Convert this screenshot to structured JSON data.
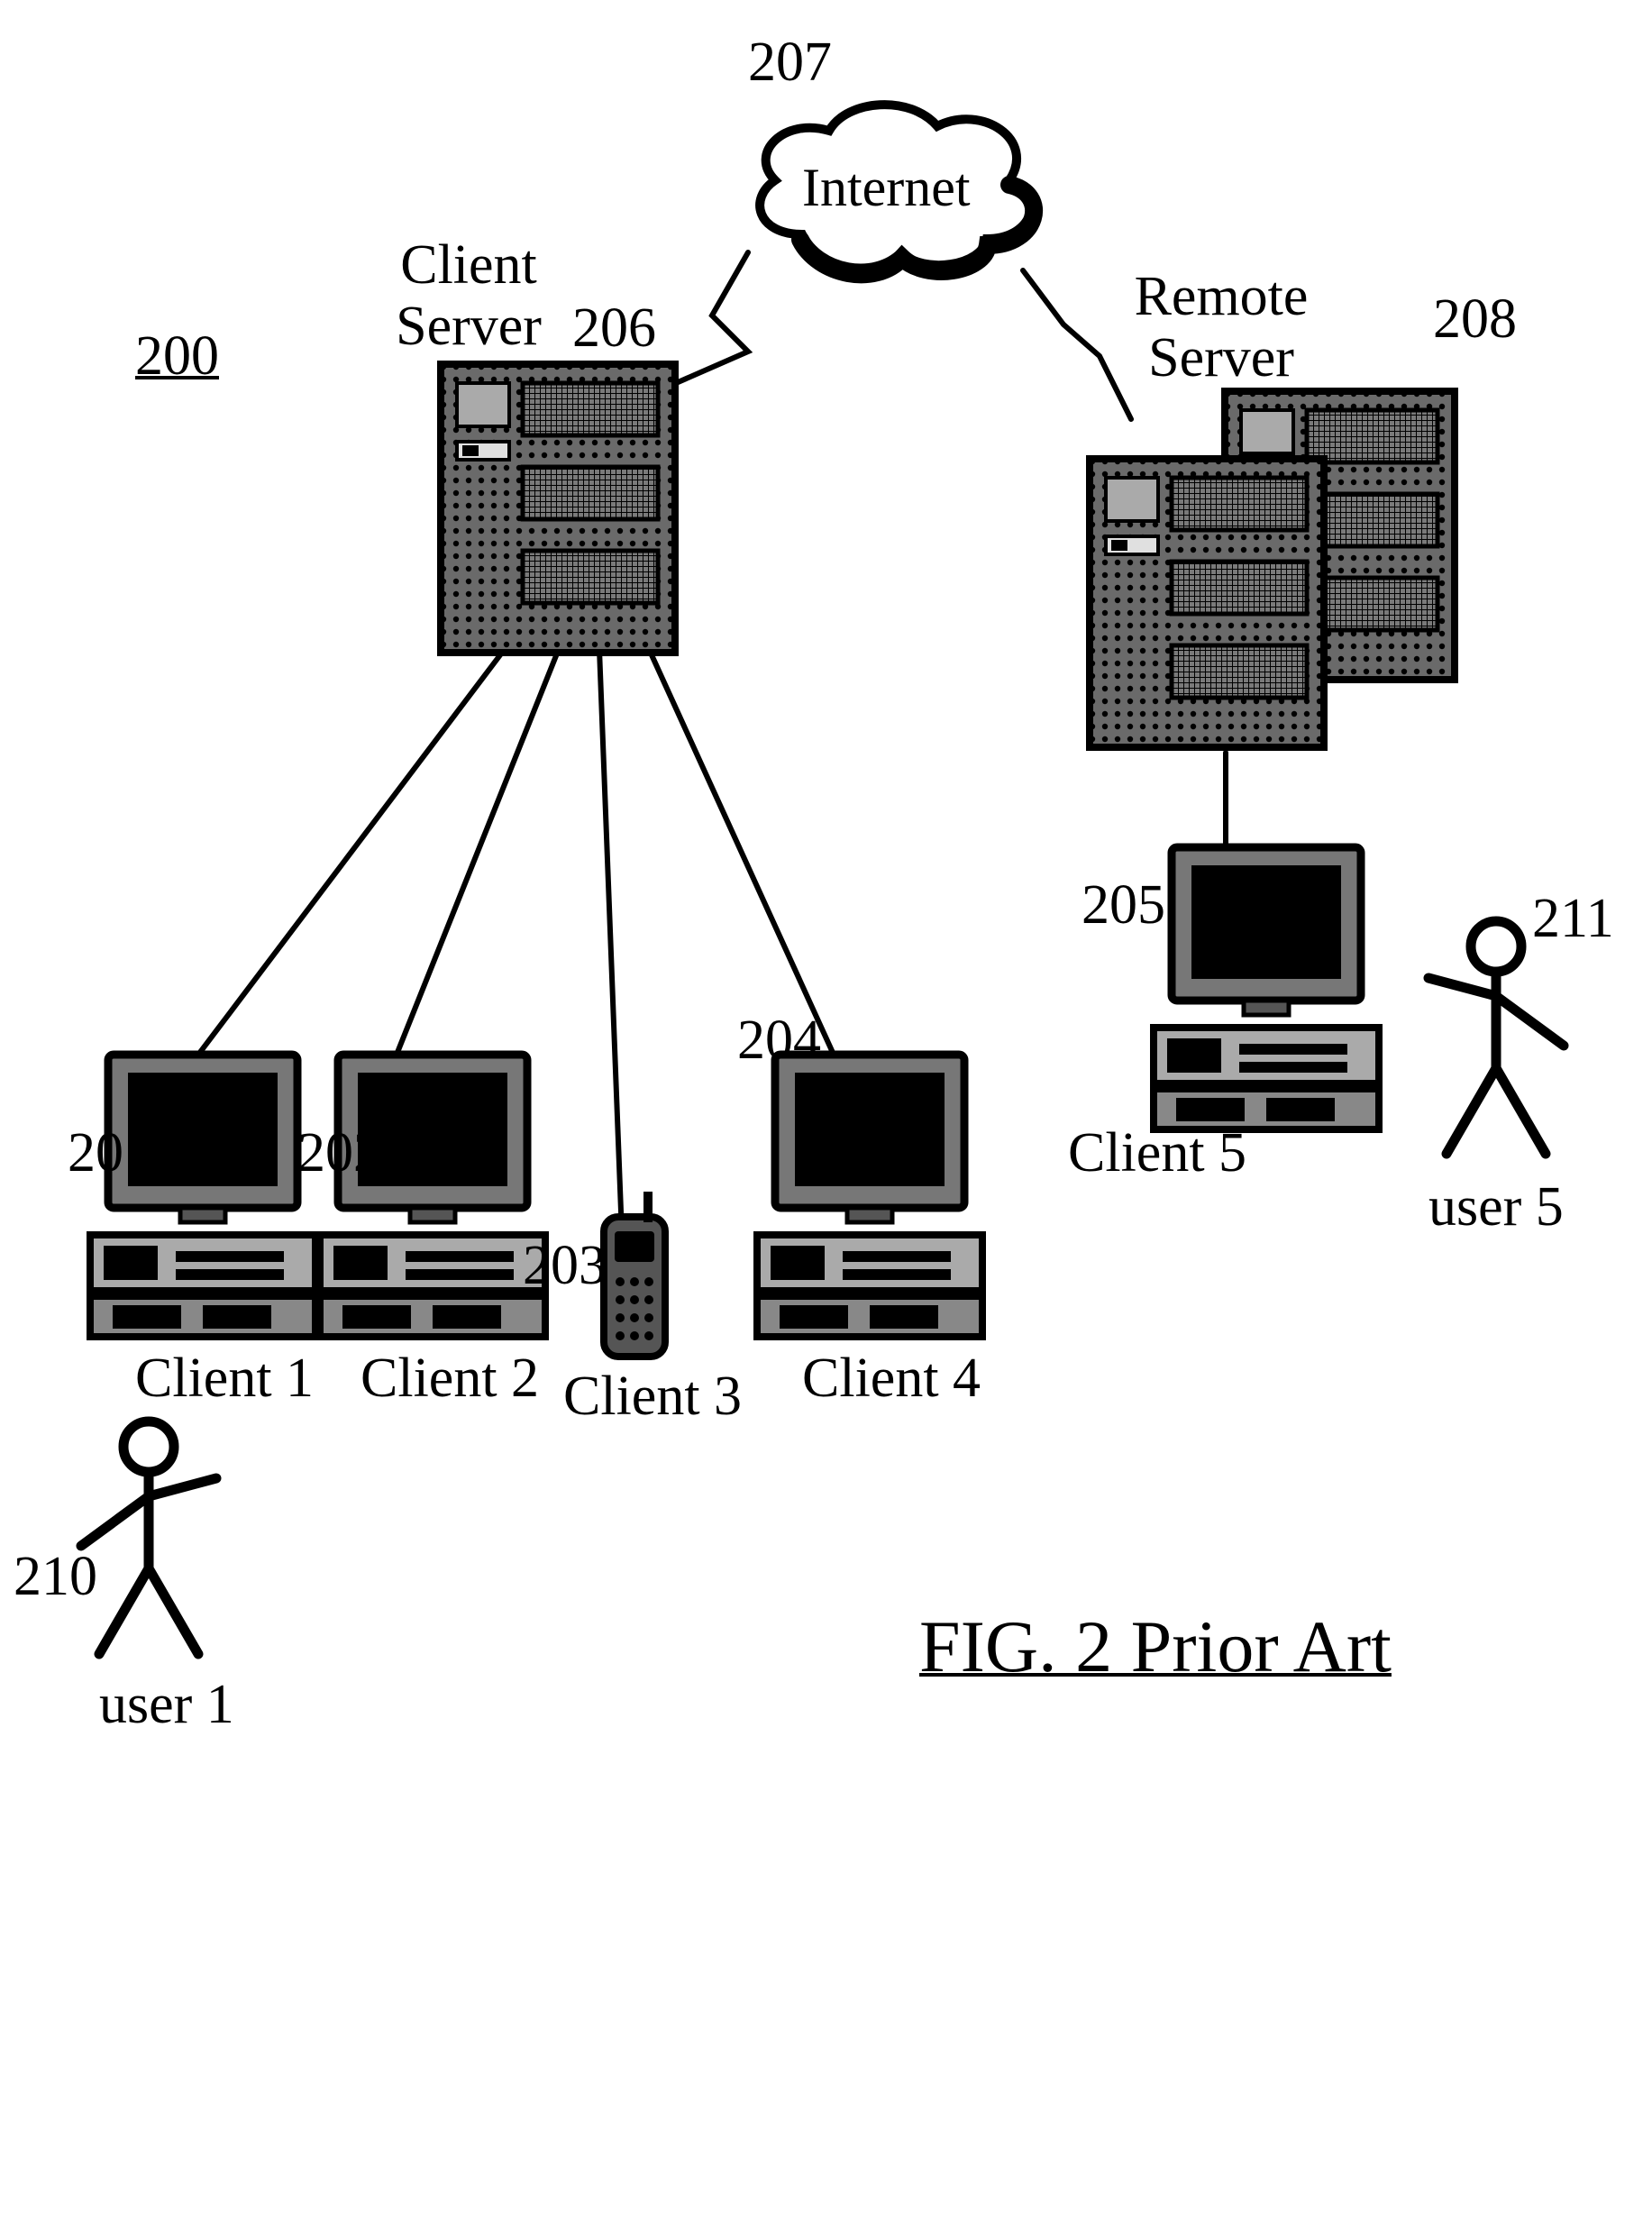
{
  "figure": {
    "ref": "200",
    "caption": "FIG. 2 Prior Art",
    "clientServer": {
      "label": "Client\nServer",
      "num": "206"
    },
    "remoteServer": {
      "label": "Remote\nServer",
      "num": "208"
    },
    "internet": {
      "label": "Internet",
      "num": "207"
    },
    "clients": {
      "c1": {
        "label": "Client 1",
        "num": "201"
      },
      "c2": {
        "label": "Client 2",
        "num": "202"
      },
      "c3": {
        "label": "Client 3",
        "num": "203"
      },
      "c4": {
        "label": "Client 4",
        "num": "204"
      },
      "c5": {
        "label": "Client 5",
        "num": "205"
      }
    },
    "users": {
      "u1": {
        "label": "user 1",
        "num": "210"
      },
      "u5": {
        "label": "user 5",
        "num": "211"
      }
    }
  }
}
